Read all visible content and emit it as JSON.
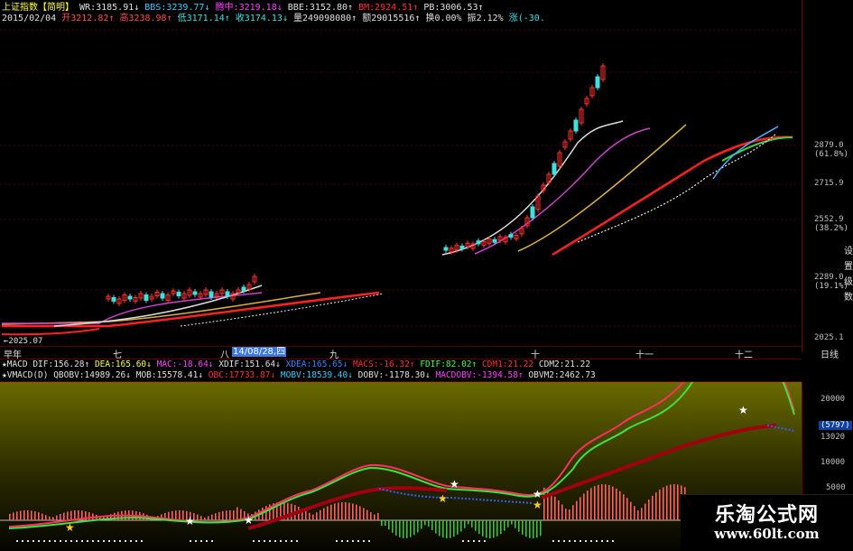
{
  "header": {
    "name": "上证指数",
    "mode": "【简明】",
    "indicators": [
      {
        "label": "WR:3185.91",
        "arrow": "↓",
        "color": "#e0e0e0"
      },
      {
        "label": "BBS:3239.77",
        "arrow": "↓",
        "color": "#40c8ff"
      },
      {
        "label": "腾中:3219.18",
        "arrow": "↓",
        "color": "#ff40ff"
      },
      {
        "label": "BBE:3152.80",
        "arrow": "↑",
        "color": "#e0e0e0"
      },
      {
        "label": "BM:2924.51",
        "arrow": "↑",
        "color": "#ff3030"
      },
      {
        "label": "PB:3006.53",
        "arrow": "↑",
        "color": "#e0e0e0"
      }
    ],
    "date": "2015/02/04",
    "quote": [
      {
        "label": "开3212.82",
        "arrow": "↑",
        "color": "#ff5050"
      },
      {
        "label": "高3238.98",
        "arrow": "↑",
        "color": "#ff5050"
      },
      {
        "label": "低3171.14",
        "arrow": "↑",
        "color": "#40e0e0"
      },
      {
        "label": "收3174.13",
        "arrow": "↓",
        "color": "#40e0e0"
      },
      {
        "label": "量249098080",
        "arrow": "↑",
        "color": "#e0e0e0"
      },
      {
        "label": "额29015516",
        "arrow": "↑",
        "color": "#e0e0e0"
      },
      {
        "label": "换0.00%",
        "arrow": "",
        "color": "#e0e0e0"
      },
      {
        "label": "振2.12%",
        "arrow": "",
        "color": "#e0e0e0"
      },
      {
        "label": "涨(-30.",
        "arrow": "",
        "color": "#40e0e0"
      }
    ]
  },
  "price_axis": [
    {
      "value": "2879.0",
      "pct": "(61.8%)"
    },
    {
      "value": "2715.9",
      "pct": ""
    },
    {
      "value": "2552.9",
      "pct": "(38.2%)"
    },
    {
      "value": "2289.0",
      "pct": "(19.1%)"
    },
    {
      "value": "2025.1",
      "pct": ""
    }
  ],
  "low_label": "←2025.07",
  "time_axis": {
    "start": "早年",
    "months": [
      "七",
      "八",
      "九",
      "十",
      "十一",
      "十二"
    ],
    "cursor_date": "14/08/28,四",
    "period": "日线"
  },
  "macd_line": [
    {
      "label": "★MACD DIF:156.28",
      "arrow": "↑",
      "color": "#e0e0e0"
    },
    {
      "label": "DEA:165.60",
      "arrow": "↓",
      "color": "#ffff40"
    },
    {
      "label": "MAC:-18.64",
      "arrow": "↓",
      "color": "#ff40ff"
    },
    {
      "label": "XDIF:151.64",
      "arrow": "↓",
      "color": "#e0e0e0"
    },
    {
      "label": "XDEA:165.65",
      "arrow": "↓",
      "color": "#4080ff"
    },
    {
      "label": "MACS:-16.32",
      "arrow": "↑",
      "color": "#ff3030"
    },
    {
      "label": "FDIF:82.02",
      "arrow": "↑",
      "color": "#40ff40"
    },
    {
      "label": "CDM1:21.22",
      "arrow": "",
      "color": "#ff3030"
    },
    {
      "label": "CDM2:21.22",
      "arrow": "",
      "color": "#e0e0e0"
    }
  ],
  "vmacd_line": [
    {
      "label": "★VMACD(D) QBOBV:14989.26",
      "arrow": "↓",
      "color": "#e0e0e0"
    },
    {
      "label": "MOB:15578.41",
      "arrow": "↓",
      "color": "#e0e0e0"
    },
    {
      "label": "OBC:17733.87",
      "arrow": "↓",
      "color": "#ff3030"
    },
    {
      "label": "MOBV:18539.40",
      "arrow": "↓",
      "color": "#40c8ff"
    },
    {
      "label": "DOBV:-1178.30",
      "arrow": "↓",
      "color": "#e0e0e0"
    },
    {
      "label": "MACDOBV:-1394.58",
      "arrow": "↑",
      "color": "#ff40ff"
    },
    {
      "label": "OBVM2:2462.73",
      "arrow": "",
      "color": "#e0e0e0"
    }
  ],
  "right_side": [
    "设",
    "置",
    "级",
    "数"
  ],
  "osc_axis": [
    {
      "value": "20000",
      "highlight": false
    },
    {
      "value": "(5797)",
      "highlight": true
    },
    {
      "value": "13020",
      "highlight": false
    },
    {
      "value": "10000",
      "highlight": false
    },
    {
      "value": "5000",
      "highlight": false
    }
  ],
  "watermark": {
    "title": "乐淘公式网",
    "url": "www.60lt.com"
  },
  "colors": {
    "up": "#ff3030",
    "down": "#40e0e0",
    "background": "#000000",
    "panel_top": "#6a6a00"
  }
}
